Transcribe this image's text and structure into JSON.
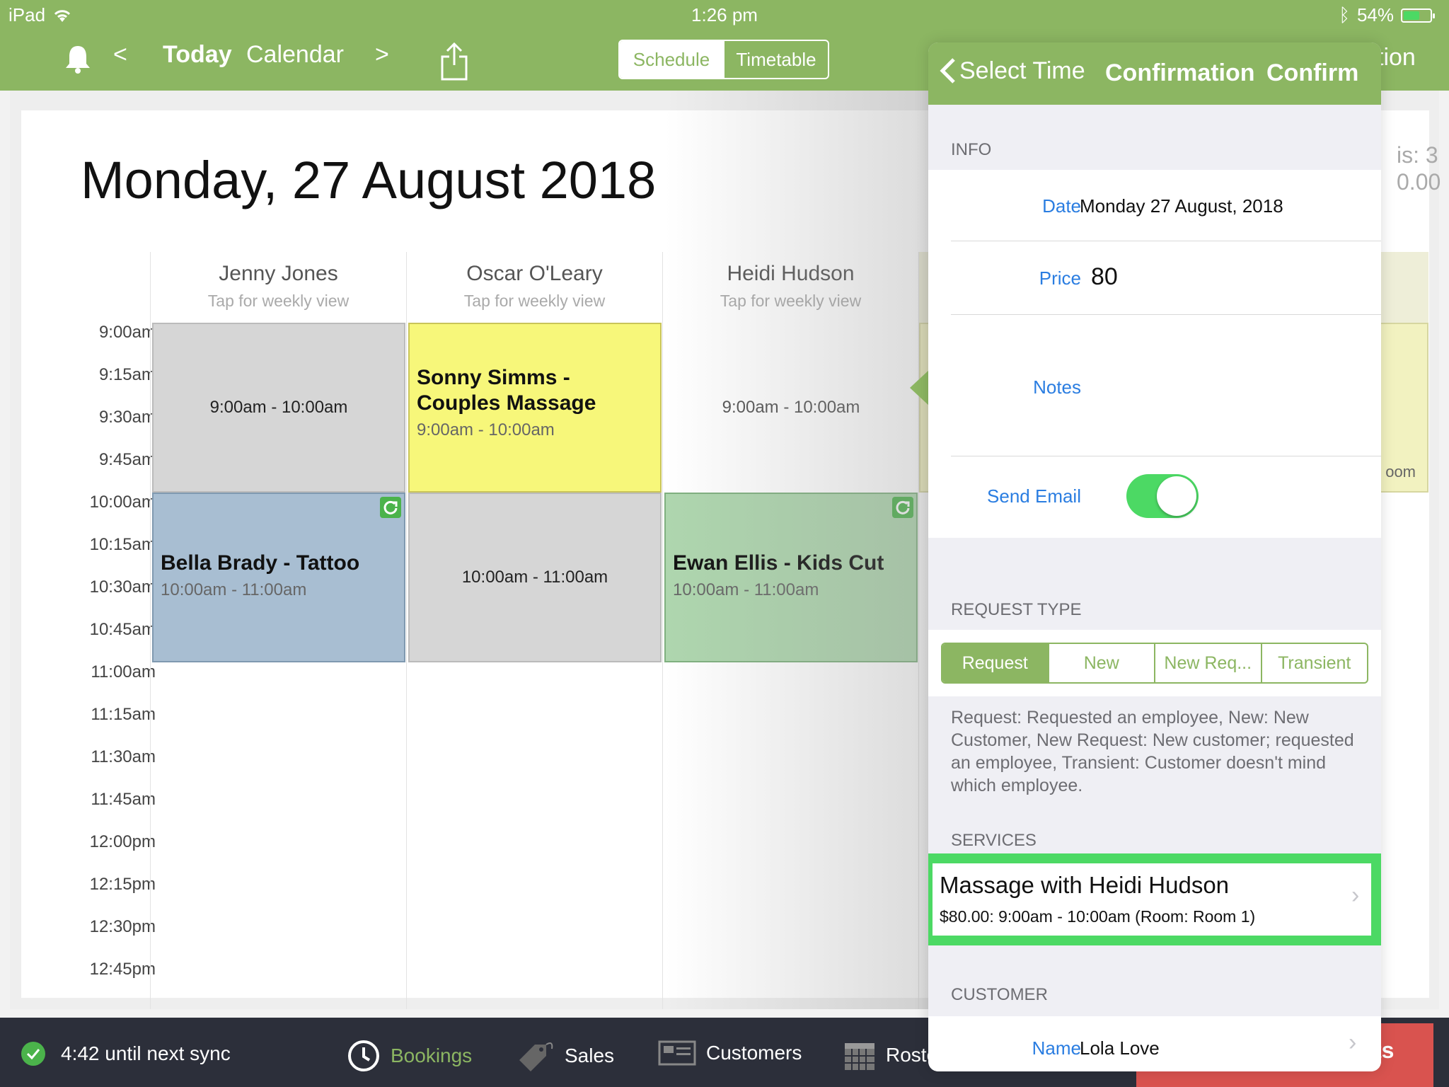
{
  "status_bar": {
    "device": "iPad",
    "time": "1:26 pm",
    "battery_pct": "54%"
  },
  "header": {
    "prev_label": "<",
    "today_label": "Today",
    "calendar_label": "Calendar",
    "next_label": ">",
    "segments": [
      "Schedule",
      "Timetable"
    ],
    "right_partial": "tion"
  },
  "calendar": {
    "date_title": "Monday, 27 August 2018",
    "peek_lines": [
      "is: 3",
      "0.00"
    ],
    "peek_room": "oom",
    "times": [
      "9:00am",
      "9:15am",
      "9:30am",
      "9:45am",
      "10:00am",
      "10:15am",
      "10:30am",
      "10:45am",
      "11:00am",
      "11:15am",
      "11:30am",
      "11:45am",
      "12:00pm",
      "12:15pm",
      "12:30pm",
      "12:45pm"
    ],
    "columns": [
      {
        "name": "Jenny Jones",
        "sub": "Tap for weekly view"
      },
      {
        "name": "Oscar O'Leary",
        "sub": "Tap for weekly view"
      },
      {
        "name": "Heidi Hudson",
        "sub": "Tap for weekly view"
      }
    ],
    "events": {
      "jj_9": "9:00am - 10:00am",
      "oo_9_title": "Sonny Simms - Couples Massage",
      "oo_9_time": "9:00am - 10:00am",
      "hh_9": "9:00am - 10:00am",
      "jj_10_title": "Bella Brady - Tattoo",
      "jj_10_time": "10:00am - 11:00am",
      "oo_10": "10:00am - 11:00am",
      "hh_10_title": "Ewan Ellis - Kids Cut",
      "hh_10_time": "10:00am - 11:00am"
    }
  },
  "bottom_bar": {
    "sync_text": "4:42 until next sync",
    "tabs": [
      "Bookings",
      "Sales",
      "Customers",
      "Roste"
    ],
    "red_button_partial": "ts"
  },
  "popover": {
    "back_label": "Select Time",
    "title": "Confirmation",
    "confirm_label": "Confirm",
    "info_header": "INFO",
    "date_label": "Date",
    "date_value": "Monday 27 August, 2018",
    "price_label": "Price",
    "price_value": "80",
    "notes_label": "Notes",
    "send_email_label": "Send Email",
    "send_email_on": true,
    "request_type_header": "REQUEST TYPE",
    "request_types": [
      "Request",
      "New",
      "New Req...",
      "Transient"
    ],
    "request_help": "Request: Requested an employee, New: New Customer, New Request: New customer; requested an employee, Transient: Customer doesn't mind which employee.",
    "services_header": "SERVICES",
    "service_title": "Massage with Heidi Hudson",
    "service_detail": "$80.00: 9:00am - 10:00am (Room: Room 1)",
    "customer_header": "CUSTOMER",
    "customer_name_label": "Name",
    "customer_name_value": "Lola Love"
  },
  "colors": {
    "brand_green": "#8cb662",
    "highlight_green": "#4cd964",
    "link_blue": "#2a7de1"
  }
}
